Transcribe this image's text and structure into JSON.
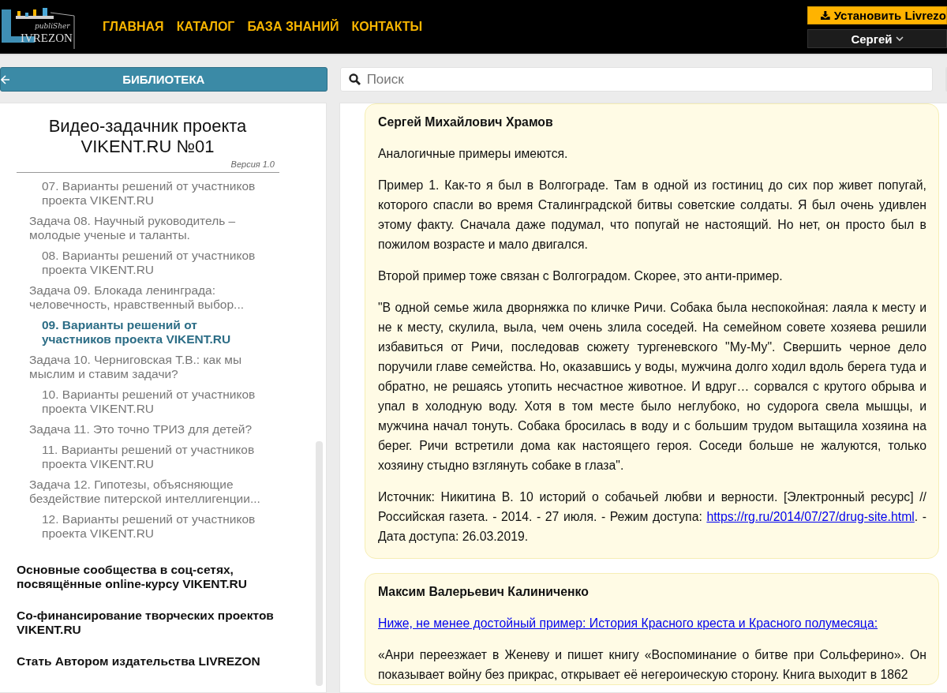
{
  "header": {
    "logo": {
      "script": "publiSher",
      "wordmark": "IVREZON"
    },
    "nav": [
      "ГЛАВНАЯ",
      "КАТАЛОГ",
      "БАЗА ЗНАНИЙ",
      "КОНТАКТЫ"
    ],
    "install_button": "Установить Livrezo",
    "user_menu": "Сергей"
  },
  "library_button": "БИБЛИОТЕКА",
  "search": {
    "placeholder": "Поиск"
  },
  "sidebar": {
    "title": "Видео-задачник проекта VIKENT.RU №01",
    "version": "Версия 1.0",
    "toc": [
      {
        "children": [
          {
            "label": "07. Варианты решений от участников проекта VIKENT.RU",
            "selected": false
          }
        ]
      },
      {
        "label": "Задача 08. Научный руководитель – молодые ученые и таланты.",
        "selected": false,
        "children": [
          {
            "label": "08. Варианты решений от участников проекта VIKENT.RU",
            "selected": false
          }
        ]
      },
      {
        "label": "Задача 09. Блокада ленинграда: человечность, нравственный выбор...",
        "selected": false,
        "children": [
          {
            "label": "09. Варианты решений от участников проекта VIKENT.RU",
            "selected": true
          }
        ]
      },
      {
        "label": "Задача 10. Черниговская Т.В.: как мы мыслим и ставим задачи?",
        "selected": false,
        "children": [
          {
            "label": "10. Варианты решений от участников проекта VIKENT.RU",
            "selected": false
          }
        ]
      },
      {
        "label": "Задача 11. Это точно ТРИЗ для детей?",
        "selected": false,
        "children": [
          {
            "label": "11. Варианты решений от участников проекта VIKENT.RU",
            "selected": false
          }
        ]
      },
      {
        "label": "Задача 12. Гипотезы, объясняющие бездействие питерской интеллигенции...",
        "selected": false,
        "children": [
          {
            "label": "12. Варианты решений от участников проекта VIKENT.RU",
            "selected": false
          }
        ]
      }
    ],
    "links": [
      "Основные сообщества в соц-сетях, посвящённые online-курсу VIKENT.RU",
      "Со-финансирование творческих проектов VIKENT.RU",
      "Стать Автором издательства LIVREZON"
    ]
  },
  "comments": [
    {
      "author": "Сергей Михайлович Храмов",
      "paragraphs": [
        {
          "kind": "text",
          "text": "Аналогичные примеры имеются."
        },
        {
          "kind": "text",
          "text": "Пример 1. Как-то я был в Волгограде. Там в одной из гостиниц до сих пор живет попугай, которого спасли во время Сталинградской битвы советские солдаты. Я был очень удивлен этому факту.  Сначала даже подумал, что попугай не настоящий. Но нет, он просто был в пожилом возрасте и мало двигался."
        },
        {
          "kind": "text",
          "text": "Второй пример тоже связан с Волгоградом. Скорее, это анти-пример."
        },
        {
          "kind": "text",
          "text": "\"В одной семье жила дворняжка по кличке Ричи. Собака была неспокойная: лаяла к месту и не к месту, скулила, выла, чем очень злила соседей. На семейном совете хозяева решили избавиться от Ричи, последовав сюжету тургеневского \"Му-Му\". Свершить черное дело поручили главе семейства. Но, оказавшись у воды, мужчина долго ходил вдоль берега туда и обратно, не решаясь утопить несчастное животное. И вдруг… сорвался с крутого обрыва и упал в холодную воду. Хотя в том месте было неглубоко, но судорога свела мышцы, и мужчина начал тонуть. Собака бросилась в воду и с большим трудом вытащила хозяина на берег. Ричи встретили дома как настоящего героя. Соседи больше не жалуются, только хозяину стыдно взглянуть собаке в глаза\"."
        },
        {
          "kind": "source",
          "before": "Источник: Никитина В. 10 историй о собачьей любви и верности. [Электронный ресурс] // Российская газета. - 2014. - 27 июля. - Режим доступа: ",
          "link": "https://rg.ru/2014/07/27/drug-site.html",
          "after": ". - Дата доступа: 26.03.2019."
        }
      ]
    },
    {
      "author": "Максим Валерьевич Калиниченко",
      "paragraphs": [
        {
          "kind": "link",
          "text": "Ниже, не менее достойный пример: История Красного креста и Красного полумесяца:"
        },
        {
          "kind": "text",
          "text": "«Анри переезжает в Женеву и пишет книгу «Воспоминание о битве при Сольферино». Он показывает войну без прикрас, открывает её негероическую сторону. Книга выходит в 1862"
        }
      ]
    }
  ]
}
